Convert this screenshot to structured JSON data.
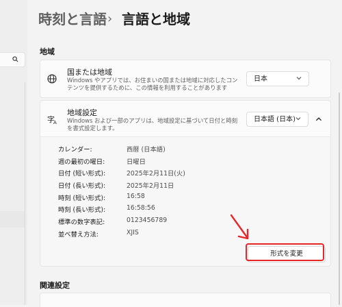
{
  "breadcrumb": {
    "parent": "時刻と言語",
    "separator": "›",
    "current": "言語と地域"
  },
  "region_section": {
    "title": "地域"
  },
  "country_card": {
    "title": "国または地域",
    "description": "Windows やアプリでは、お住まいの国または地域に対応したコンテンツを提供するために、この情報を利用することがあります",
    "value": "日本"
  },
  "format_card": {
    "title": "地域設定",
    "description": "Windows および一部のアプリは、地域設定に基づいて日付と時刻を書式設定します。",
    "value": "日本語 (日本)"
  },
  "details": [
    {
      "label": "カレンダー:",
      "value": "西暦 (日本語)"
    },
    {
      "label": "週の最初の曜日:",
      "value": "日曜日"
    },
    {
      "label": "日付 (短い形式):",
      "value": "2025年2月11日(火)"
    },
    {
      "label": "日付 (長い形式):",
      "value": "2025年2月11日"
    },
    {
      "label": "時刻 (短い形式):",
      "value": "16:58"
    },
    {
      "label": "時刻 (長い形式):",
      "value": "16:58:56"
    },
    {
      "label": "標準の数字表記:",
      "value": "0123456789"
    },
    {
      "label": "並べ替え方法:",
      "value": "XJIS"
    }
  ],
  "change_format_button": "形式を変更",
  "related_section": {
    "title": "関連設定"
  },
  "colors": {
    "highlight": "#e8262a",
    "background": "#f3f3f3",
    "card": "#fbfbfb"
  }
}
